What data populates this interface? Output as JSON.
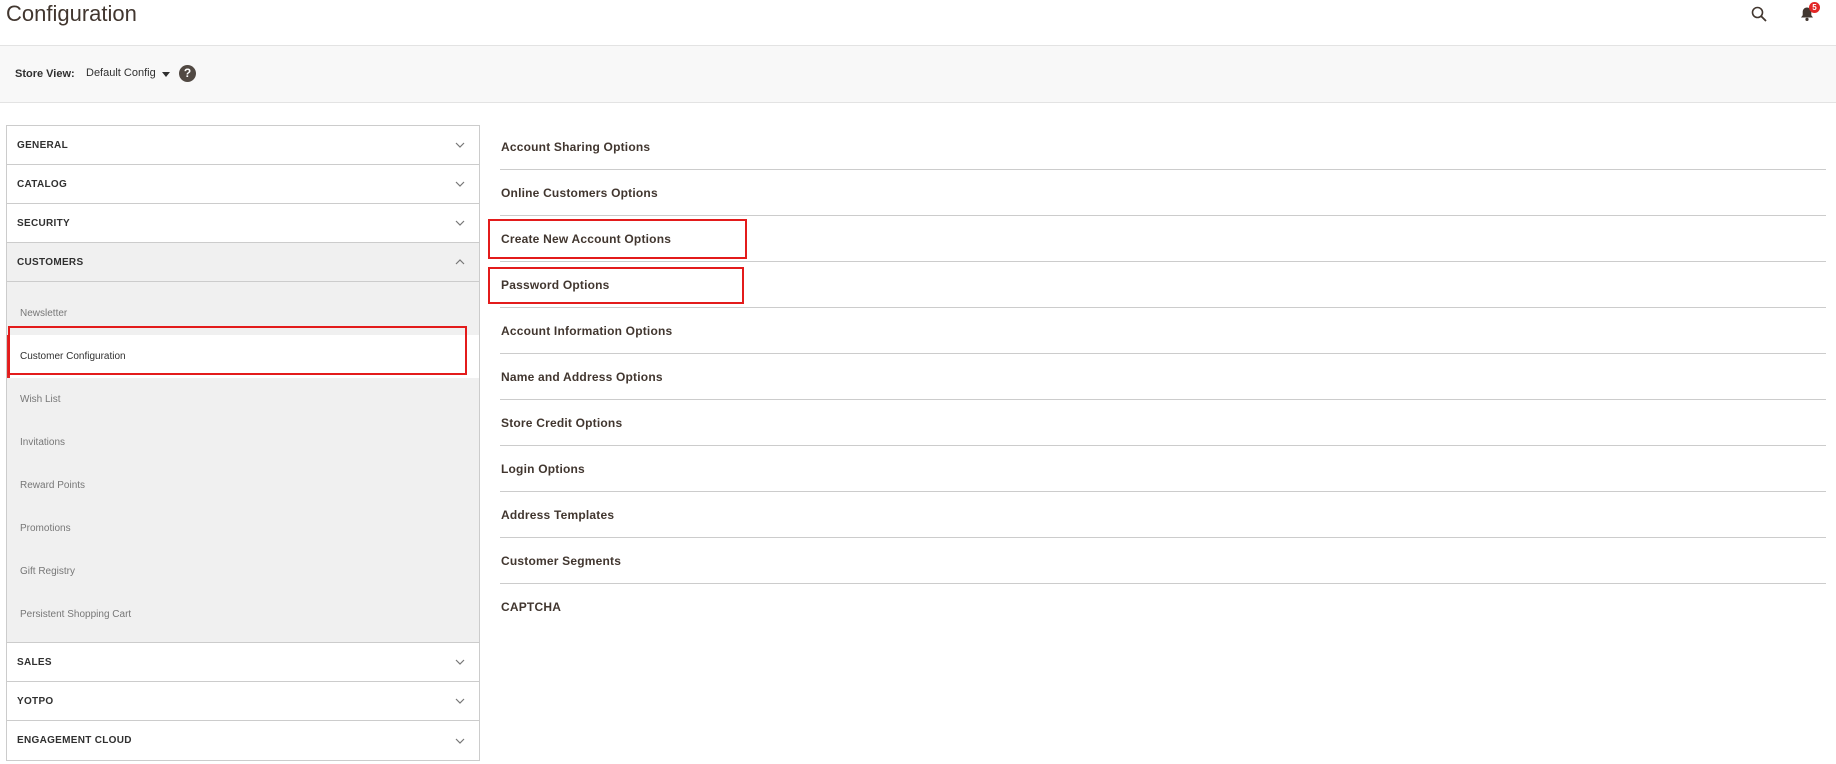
{
  "header": {
    "title": "Configuration",
    "search_icon": "search-icon",
    "notifications_icon": "bell-icon",
    "notifications_count": "5"
  },
  "store_view": {
    "label": "Store View:",
    "selected": "Default Config",
    "help_icon": "question-circle-icon",
    "help_symbol": "?"
  },
  "sidebar": {
    "sections_before": [
      {
        "label": "GENERAL"
      },
      {
        "label": "CATALOG"
      },
      {
        "label": "SECURITY"
      }
    ],
    "open_section": {
      "label": "CUSTOMERS",
      "items": [
        {
          "label": "Newsletter"
        },
        {
          "label": "Customer Configuration",
          "active": true
        },
        {
          "label": "Wish List"
        },
        {
          "label": "Invitations"
        },
        {
          "label": "Reward Points"
        },
        {
          "label": "Promotions"
        },
        {
          "label": "Gift Registry"
        },
        {
          "label": "Persistent Shopping Cart"
        }
      ]
    },
    "sections_after": [
      {
        "label": "SALES"
      },
      {
        "label": "YOTPO"
      },
      {
        "label": "ENGAGEMENT CLOUD"
      }
    ]
  },
  "config_groups": [
    {
      "label": "Account Sharing Options"
    },
    {
      "label": "Online Customers Options"
    },
    {
      "label": "Create New Account Options"
    },
    {
      "label": "Password Options"
    },
    {
      "label": "Account Information Options"
    },
    {
      "label": "Name and Address Options"
    },
    {
      "label": "Store Credit Options"
    },
    {
      "label": "Login Options"
    },
    {
      "label": "Address Templates"
    },
    {
      "label": "Customer Segments"
    },
    {
      "label": "CAPTCHA"
    }
  ],
  "colors": {
    "highlight": "#e31b1b",
    "badge": "#e22626",
    "title": "#41362f"
  }
}
